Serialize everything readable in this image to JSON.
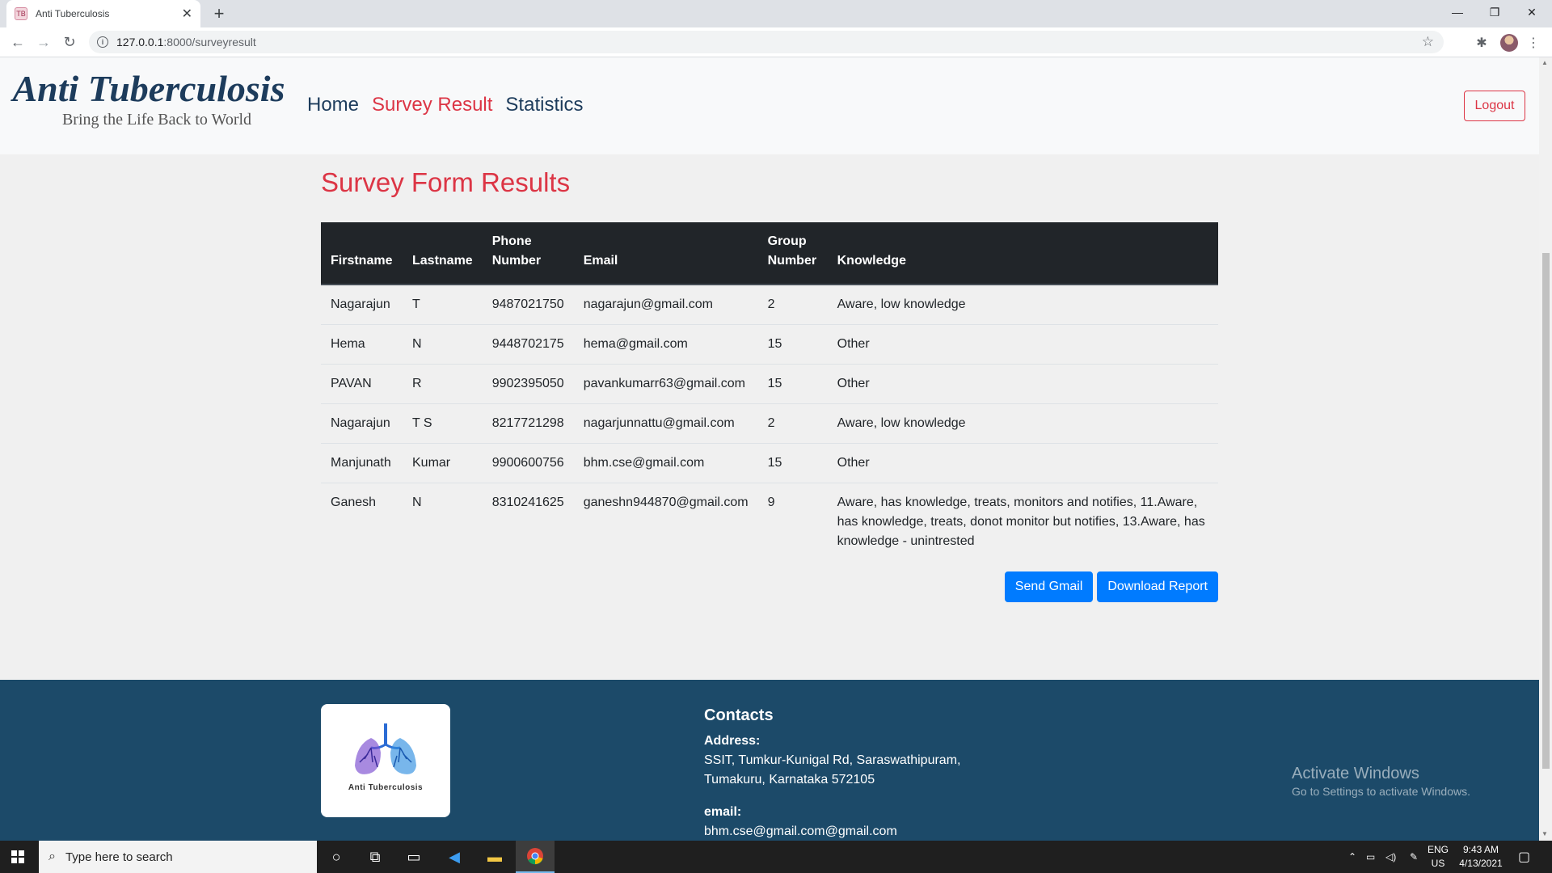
{
  "browser": {
    "tab_title": "Anti Tuberculosis",
    "url_host": "127.0.0.1",
    "url_path": ":8000/surveyresult"
  },
  "header": {
    "brand_name": "Anti Tuberculosis",
    "tagline": "Bring the Life Back to World",
    "nav": [
      "Home",
      "Survey Result",
      "Statistics"
    ],
    "active_nav": "Survey Result",
    "logout_label": "Logout"
  },
  "main": {
    "title": "Survey Form Results",
    "columns": [
      "Firstname",
      "Lastname",
      "Phone Number",
      "Email",
      "Group Number",
      "Knowledge"
    ],
    "rows": [
      [
        "Nagarajun",
        "T",
        "9487021750",
        "nagarajun@gmail.com",
        "2",
        "Aware, low knowledge"
      ],
      [
        "Hema",
        "N",
        "9448702175",
        "hema@gmail.com",
        "15",
        "Other"
      ],
      [
        "PAVAN",
        "R",
        "9902395050",
        "pavankumarr63@gmail.com",
        "15",
        "Other"
      ],
      [
        "Nagarajun",
        "T S",
        "8217721298",
        "nagarjunnattu@gmail.com",
        "2",
        "Aware, low knowledge"
      ],
      [
        "Manjunath",
        "Kumar",
        "9900600756",
        "bhm.cse@gmail.com",
        "15",
        "Other"
      ],
      [
        "Ganesh",
        "N",
        "8310241625",
        "ganeshn944870@gmail.com",
        "9",
        "Aware, has knowledge, treats, monitors and notifies, 11.Aware, has knowledge, treats, donot monitor but notifies, 13.Aware, has knowledge - unintrested"
      ]
    ],
    "send_gmail_label": "Send Gmail",
    "download_label": "Download Report"
  },
  "footer": {
    "logo_text": "Anti Tuberculosis",
    "contacts_title": "Contacts",
    "address_label": "Address:",
    "address_line1": "SSIT, Tumkur-Kunigal Rd, Saraswathipuram,",
    "address_line2": "Tumakuru, Karnataka 572105",
    "email_label": "email:",
    "email_value": "bhm.cse@gmail.com@gmail.com"
  },
  "watermark": {
    "line1": "Activate Windows",
    "line2": "Go to Settings to activate Windows."
  },
  "taskbar": {
    "search_placeholder": "Type here to search",
    "lang_top": "ENG",
    "lang_bottom": "US",
    "time": "9:43 AM",
    "date": "4/13/2021"
  },
  "colors": {
    "brand": "#1d3c5c",
    "accent_red": "#dc3545",
    "primary_blue": "#007bff",
    "footer_bg": "#1c4a69",
    "table_head_bg": "#212529"
  }
}
